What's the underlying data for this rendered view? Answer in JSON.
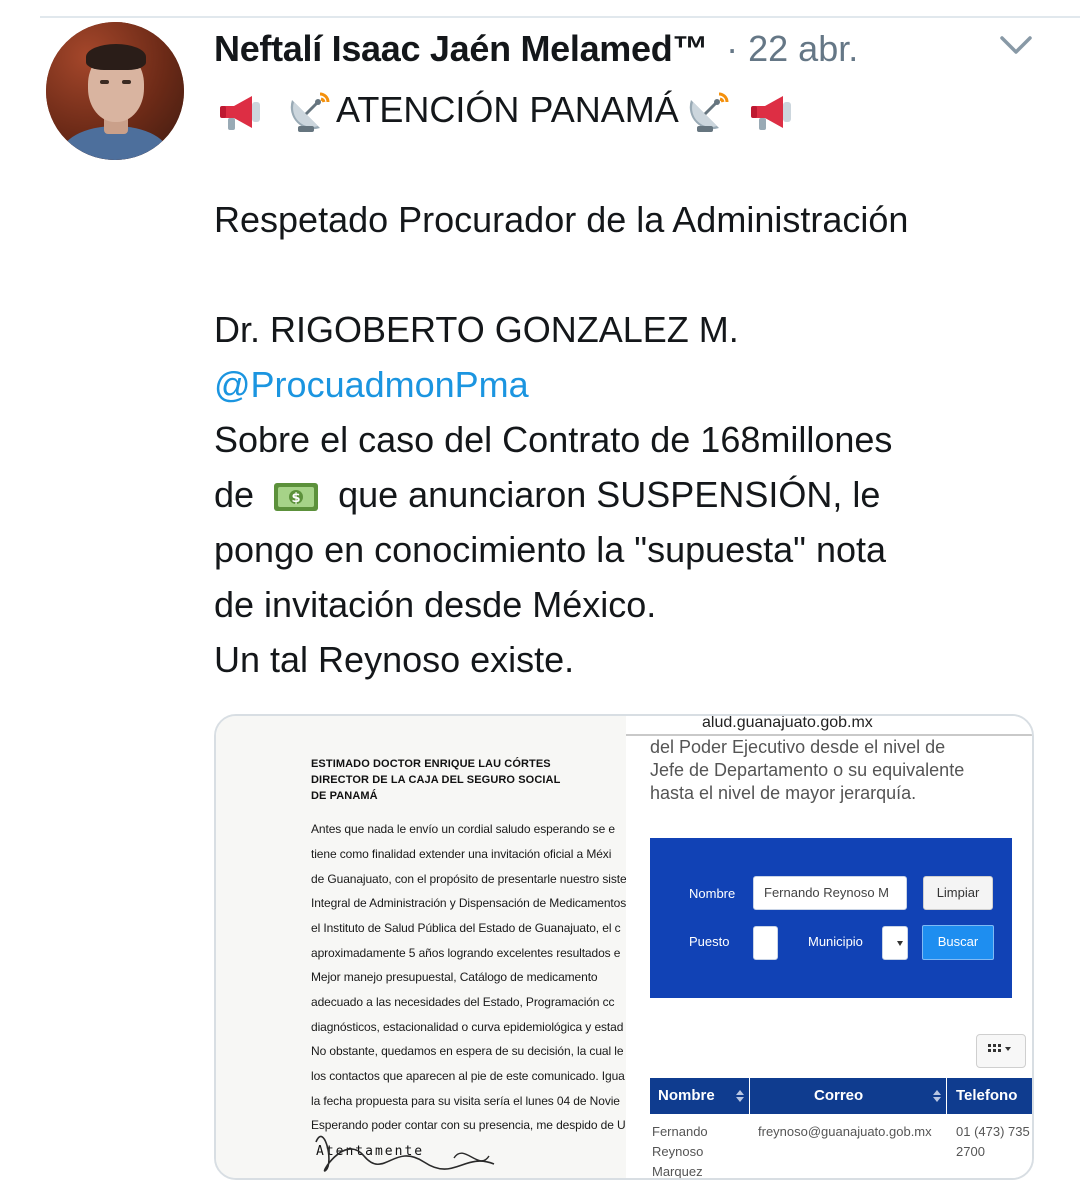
{
  "tweet": {
    "author_name": "Neftalí Isaac Jaén Melamed™",
    "separator": "·",
    "timestamp": "22 abr.",
    "menu_icon": "chevron-down-icon",
    "lines": {
      "l1": "ATENCIÓN PANAMÁ",
      "l2": "Respetado Procurador de la Administración",
      "l3": "Dr. RIGOBERTO GONZALEZ M.",
      "mention": "@ProcuadmonPma",
      "l5": "Sobre el caso del Contrato de 168millones",
      "l6a": "de",
      "l6b": "que anunciaron SUSPENSIÓN, le",
      "l7": "pongo en conocimiento la \"supuesta\" nota",
      "l8": "de invitación desde México.",
      "l9": "Un tal Reynoso existe."
    },
    "emoji": {
      "megaphone": "megaphone-icon",
      "satellite": "satellite-antenna-icon",
      "money": "dollar-banknote-icon"
    },
    "colors": {
      "text": "#14171a",
      "muted": "#657786",
      "link": "#1b95e0"
    }
  },
  "media": {
    "letter": {
      "heading1": "ESTIMADO DOCTOR ENRIQUE LAU CÓRTES",
      "heading2": "DIRECTOR DE LA CAJA DEL SEGURO SOCIAL",
      "heading3": "DE PANAMÁ",
      "body": [
        "Antes que nada le envío un cordial saludo esperando se e",
        "tiene como finalidad extender una invitación oficial  a  Méxi",
        "de Guanajuato, con el propósito de presentarle nuestro siste",
        "Integral de Administración y Dispensación de Medicamentos",
        "el Instituto de Salud Pública del Estado de Guanajuato, el c",
        "aproximadamente 5 años logrando excelentes resultados e",
        "Mejor  manejo  presupuestal,  Catálogo  de  medicamento",
        "adecuado a las necesidades del Estado, Programación cc",
        "diagnósticos, estacionalidad o curva epidemiológica y estad",
        "No obstante, quedamos en espera de su decisión, la cual le",
        "los contactos que aparecen al pie de este comunicado. Igua",
        "la fecha propuesta para su visita sería el lunes 04 de Novie",
        "Esperando poder contar con su presencia, me despido de U"
      ],
      "closing": "Atentamente"
    },
    "site": {
      "url_fragment": "alud.guanajuato.gob.mx",
      "intro_1": "del Poder Ejecutivo desde el nivel de",
      "intro_2": "Jefe de Departamento o su equivalente",
      "intro_3": "hasta el nivel de mayor jerarquía.",
      "form": {
        "nombre_label": "Nombre",
        "nombre_value": "Fernando Reynoso M",
        "limpiar_label": "Limpiar",
        "puesto_label": "Puesto",
        "puesto_value": "",
        "municipio_label": "Municipio",
        "municipio_value": "",
        "buscar_label": "Buscar"
      },
      "columns_button": "grid-icon",
      "table": {
        "headers": [
          "Nombre",
          "Correo",
          "Telefono"
        ],
        "row": {
          "nombre_1": "Fernando",
          "nombre_2": "Reynoso",
          "nombre_3": "Marquez",
          "correo": "freynoso@guanajuato.gob.mx",
          "telefono_1": "01 (473) 735",
          "telefono_2": "2700"
        }
      },
      "colors": {
        "form_bg": "#1142b5",
        "table_header": "#0f3c8f",
        "button_blue": "#1e8ef0"
      }
    }
  }
}
